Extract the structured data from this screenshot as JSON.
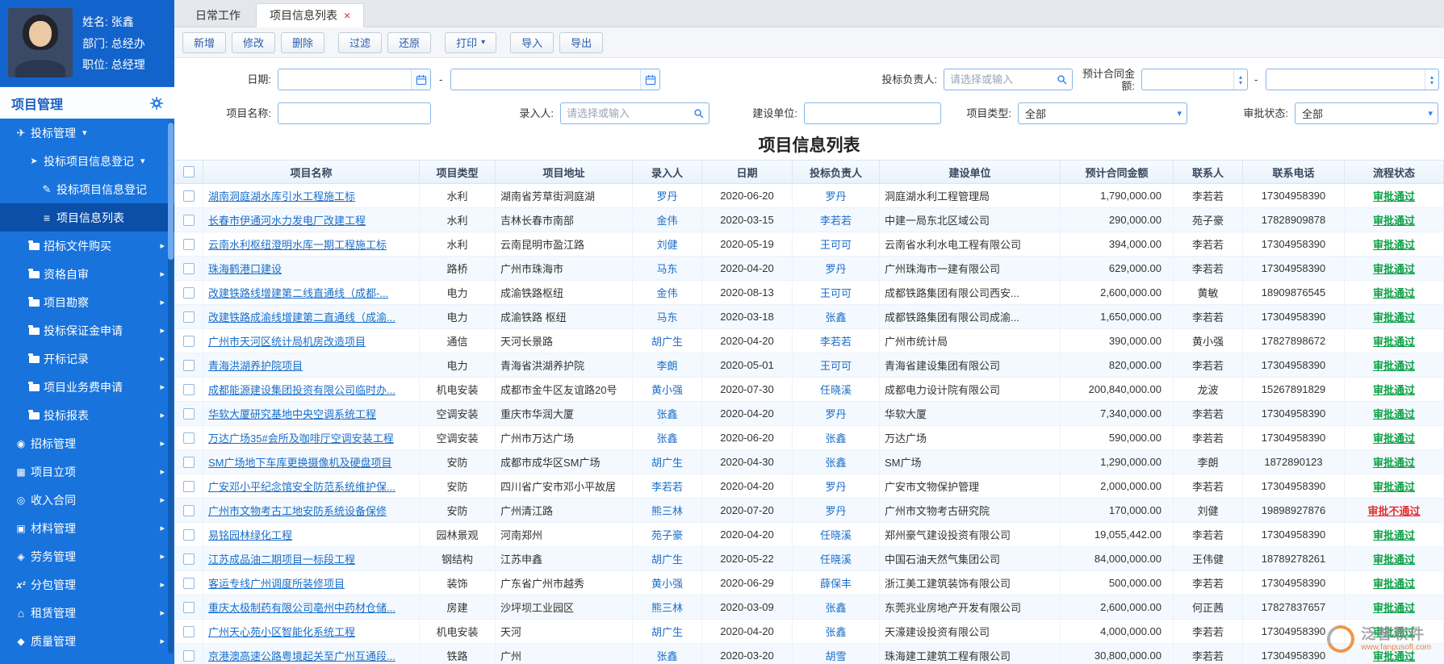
{
  "user": {
    "name": "姓名: 张鑫",
    "department": "部门: 总经办",
    "position": "职位: 总经理"
  },
  "sidebar": {
    "section_title": "项目管理",
    "menu": [
      {
        "label": "投标管理",
        "cls": "lv1",
        "icon": "ic-plane",
        "arrow": "ar-down"
      },
      {
        "label": "投标项目信息登记",
        "cls": "lv2",
        "icon": "ic-send",
        "arrow": "ar-down"
      },
      {
        "label": "投标项目信息登记",
        "cls": "lv3",
        "icon": "ic-edit",
        "arrow": "ar-none"
      },
      {
        "label": "项目信息列表",
        "cls": "lv3 active",
        "icon": "ic-list",
        "arrow": "ar-none"
      },
      {
        "label": "招标文件购买",
        "cls": "lv2",
        "icon": "ic-folder",
        "arrow": "ar-right"
      },
      {
        "label": "资格自审",
        "cls": "lv2",
        "icon": "ic-folder",
        "arrow": "ar-right"
      },
      {
        "label": "项目勘察",
        "cls": "lv2",
        "icon": "ic-folder",
        "arrow": "ar-right"
      },
      {
        "label": "投标保证金申请",
        "cls": "lv2",
        "icon": "ic-folder",
        "arrow": "ar-right"
      },
      {
        "label": "开标记录",
        "cls": "lv2",
        "icon": "ic-folder",
        "arrow": "ar-right"
      },
      {
        "label": "项目业务费申请",
        "cls": "lv2",
        "icon": "ic-folder",
        "arrow": "ar-right"
      },
      {
        "label": "投标报表",
        "cls": "lv2",
        "icon": "ic-folder",
        "arrow": "ar-right"
      },
      {
        "label": "招标管理",
        "cls": "lv1",
        "icon": "ic-drop",
        "arrow": "ar-right"
      },
      {
        "label": "项目立项",
        "cls": "lv1",
        "icon": "ic-box",
        "arrow": "ar-right"
      },
      {
        "label": "收入合同",
        "cls": "lv1",
        "icon": "ic-target",
        "arrow": "ar-right"
      },
      {
        "label": "材料管理",
        "cls": "lv1",
        "icon": "ic-cart",
        "arrow": "ar-right"
      },
      {
        "label": "劳务管理",
        "cls": "lv1",
        "icon": "ic-hands",
        "arrow": "ar-right"
      },
      {
        "label": "分包管理",
        "cls": "lv1",
        "icon": "ic-x2",
        "arrow": "ar-right"
      },
      {
        "label": "租赁管理",
        "cls": "lv1",
        "icon": "ic-home",
        "arrow": "ar-right"
      },
      {
        "label": "质量管理",
        "cls": "lv1",
        "icon": "ic-shield",
        "arrow": "ar-right"
      }
    ]
  },
  "tabs": {
    "daily": {
      "label": "日常工作"
    },
    "active": {
      "label": "项目信息列表",
      "close_icon": "×"
    }
  },
  "toolbar": {
    "buttons": [
      {
        "label": "新增",
        "cls": ""
      },
      {
        "label": "修改",
        "cls": ""
      },
      {
        "label": "删除",
        "cls": ""
      },
      {
        "label": "过滤",
        "cls": "grp"
      },
      {
        "label": "还原",
        "cls": ""
      },
      {
        "label": "打印",
        "cls": "grp has-caret"
      },
      {
        "label": "导入",
        "cls": "grp"
      },
      {
        "label": "导出",
        "cls": ""
      }
    ]
  },
  "filters": {
    "date_label": "日期:",
    "range_separator": "-",
    "bid_leader_label": "投标负责人:",
    "amount_label": "预计合同金额:",
    "project_name_label": "项目名称:",
    "entry_person_label": "录入人:",
    "build_unit_label": "建设单位:",
    "project_type_label": "项目类型:",
    "approval_status_label": "审批状态:",
    "select_placeholder": "请选择或输入",
    "project_type_value": "全部",
    "approval_status_value": "全部"
  },
  "table": {
    "title": "项目信息列表",
    "columns": [
      "项目名称",
      "项目类型",
      "项目地址",
      "录入人",
      "日期",
      "投标负责人",
      "建设单位",
      "预计合同金额",
      "联系人",
      "联系电话",
      "流程状态"
    ],
    "rows": [
      {
        "name": "湖南洞庭湖水库引水工程施工标",
        "type": "水利",
        "address": "湖南省芳草街洞庭湖",
        "entry": "罗丹",
        "date": "2020-06-20",
        "leader": "罗丹",
        "unit": "洞庭湖水利工程管理局",
        "amount": "1,790,000.00",
        "contact": "李若若",
        "phone": "17304958390",
        "status": "审批通过",
        "status_cls": "st-pass"
      },
      {
        "name": "长春市伊通河水力发电厂改建工程",
        "type": "水利",
        "address": "吉林长春市南部",
        "entry": "金伟",
        "date": "2020-03-15",
        "leader": "李若若",
        "unit": "中建一局东北区域公司",
        "amount": "290,000.00",
        "contact": "苑子豪",
        "phone": "17828909878",
        "status": "审批通过",
        "status_cls": "st-pass"
      },
      {
        "name": "云南水利枢纽澄明水库一期工程施工标",
        "type": "水利",
        "address": "云南昆明市盈江路",
        "entry": "刘健",
        "date": "2020-05-19",
        "leader": "王可可",
        "unit": "云南省水利水电工程有限公司",
        "amount": "394,000.00",
        "contact": "李若若",
        "phone": "17304958390",
        "status": "审批通过",
        "status_cls": "st-pass"
      },
      {
        "name": "珠海鹤港口建设",
        "type": "路桥",
        "address": "广州市珠海市",
        "entry": "马东",
        "date": "2020-04-20",
        "leader": "罗丹",
        "unit": "广州珠海市一建有限公司",
        "amount": "629,000.00",
        "contact": "李若若",
        "phone": "17304958390",
        "status": "审批通过",
        "status_cls": "st-pass"
      },
      {
        "name": "改建铁路线增建第二线直通线（成都-...",
        "type": "电力",
        "address": "成渝铁路枢纽",
        "entry": "金伟",
        "date": "2020-08-13",
        "leader": "王可可",
        "unit": "成都铁路集团有限公司西安...",
        "amount": "2,600,000.00",
        "contact": "黄敏",
        "phone": "18909876545",
        "status": "审批通过",
        "status_cls": "st-pass"
      },
      {
        "name": "改建铁路成渝线增建第二直通线（成渝...",
        "type": "电力",
        "address": "成渝铁路 枢纽",
        "entry": "马东",
        "date": "2020-03-18",
        "leader": "张鑫",
        "unit": "成都铁路集团有限公司成渝...",
        "amount": "1,650,000.00",
        "contact": "李若若",
        "phone": "17304958390",
        "status": "审批通过",
        "status_cls": "st-pass"
      },
      {
        "name": "广州市天河区统计局机房改造项目",
        "type": "通信",
        "address": "天河长景路",
        "entry": "胡广生",
        "date": "2020-04-20",
        "leader": "李若若",
        "unit": "广州市统计局",
        "amount": "390,000.00",
        "contact": "黄小强",
        "phone": "17827898672",
        "status": "审批通过",
        "status_cls": "st-pass"
      },
      {
        "name": "青海洪湖养护院项目",
        "type": "电力",
        "address": "青海省洪湖养护院",
        "entry": "李朗",
        "date": "2020-05-01",
        "leader": "王可可",
        "unit": "青海省建设集团有限公司",
        "amount": "820,000.00",
        "contact": "李若若",
        "phone": "17304958390",
        "status": "审批通过",
        "status_cls": "st-pass"
      },
      {
        "name": "成都能源建设集团投资有限公司临时办...",
        "type": "机电安装",
        "address": "成都市金牛区友谊路20号",
        "entry": "黄小强",
        "date": "2020-07-30",
        "leader": "任晓溪",
        "unit": "成都电力设计院有限公司",
        "amount": "200,840,000.00",
        "contact": "龙波",
        "phone": "15267891829",
        "status": "审批通过",
        "status_cls": "st-pass"
      },
      {
        "name": "华软大厦研究基地中央空调系统工程",
        "type": "空调安装",
        "address": "重庆市华润大厦",
        "entry": "张鑫",
        "date": "2020-04-20",
        "leader": "罗丹",
        "unit": "华软大厦",
        "amount": "7,340,000.00",
        "contact": "李若若",
        "phone": "17304958390",
        "status": "审批通过",
        "status_cls": "st-pass"
      },
      {
        "name": "万达广场35#会所及咖啡厅空调安装工程",
        "type": "空调安装",
        "address": "广州市万达广场",
        "entry": "张鑫",
        "date": "2020-06-20",
        "leader": "张鑫",
        "unit": "万达广场",
        "amount": "590,000.00",
        "contact": "李若若",
        "phone": "17304958390",
        "status": "审批通过",
        "status_cls": "st-pass"
      },
      {
        "name": "SM广场地下车库更换摄像机及硬盘项目",
        "type": "安防",
        "address": "成都市成华区SM广场",
        "entry": "胡广生",
        "date": "2020-04-30",
        "leader": "张鑫",
        "unit": "SM广场",
        "amount": "1,290,000.00",
        "contact": "李朗",
        "phone": "1872890123",
        "status": "审批通过",
        "status_cls": "st-pass"
      },
      {
        "name": "广安邓小平纪念馆安全防范系统维护保...",
        "type": "安防",
        "address": "四川省广安市邓小平故居",
        "entry": "李若若",
        "date": "2020-04-20",
        "leader": "罗丹",
        "unit": "广安市文物保护管理",
        "amount": "2,000,000.00",
        "contact": "李若若",
        "phone": "17304958390",
        "status": "审批通过",
        "status_cls": "st-pass"
      },
      {
        "name": "广州市文物考古工地安防系统设备保修",
        "type": "安防",
        "address": "广州清江路",
        "entry": "熊三林",
        "date": "2020-07-20",
        "leader": "罗丹",
        "unit": "广州市文物考古研究院",
        "amount": "170,000.00",
        "contact": "刘健",
        "phone": "19898927876",
        "status": "审批不通过",
        "status_cls": "st-fail"
      },
      {
        "name": "易铭园林绿化工程",
        "type": "园林景观",
        "address": "河南郑州",
        "entry": "苑子豪",
        "date": "2020-04-20",
        "leader": "任晓溪",
        "unit": "郑州豪气建设投资有限公司",
        "amount": "19,055,442.00",
        "contact": "李若若",
        "phone": "17304958390",
        "status": "审批通过",
        "status_cls": "st-pass"
      },
      {
        "name": "江苏成品油二期项目一标段工程",
        "type": "钢结构",
        "address": "江苏申鑫",
        "entry": "胡广生",
        "date": "2020-05-22",
        "leader": "任晓溪",
        "unit": "中国石油天然气集团公司",
        "amount": "84,000,000.00",
        "contact": "王伟健",
        "phone": "18789278261",
        "status": "审批通过",
        "status_cls": "st-pass"
      },
      {
        "name": "客运专线广州调度所装修项目",
        "type": "装饰",
        "address": "广东省广州市越秀",
        "entry": "黄小强",
        "date": "2020-06-29",
        "leader": "薛保丰",
        "unit": "浙江美工建筑装饰有限公司",
        "amount": "500,000.00",
        "contact": "李若若",
        "phone": "17304958390",
        "status": "审批通过",
        "status_cls": "st-pass"
      },
      {
        "name": "重庆太极制药有限公司亳州中药材仓储...",
        "type": "房建",
        "address": "沙坪坝工业园区",
        "entry": "熊三林",
        "date": "2020-03-09",
        "leader": "张鑫",
        "unit": "东莞兆业房地产开发有限公司",
        "amount": "2,600,000.00",
        "contact": "何正茜",
        "phone": "17827837657",
        "status": "审批通过",
        "status_cls": "st-pass"
      },
      {
        "name": "广州天心苑小区智能化系统工程",
        "type": "机电安装",
        "address": "天河",
        "entry": "胡广生",
        "date": "2020-04-20",
        "leader": "张鑫",
        "unit": "天濠建设投资有限公司",
        "amount": "4,000,000.00",
        "contact": "李若若",
        "phone": "17304958390",
        "status": "审批通过",
        "status_cls": "st-pass"
      },
      {
        "name": "京港澳高速公路粤境起关至广州互通段...",
        "type": "铁路",
        "address": "广州",
        "entry": "张鑫",
        "date": "2020-03-20",
        "leader": "胡雪",
        "unit": "珠海建工建筑工程有限公司",
        "amount": "30,800,000.00",
        "contact": "李若若",
        "phone": "17304958390",
        "status": "审批通过",
        "status_cls": "st-pass"
      }
    ]
  },
  "watermark": {
    "brand": "泛普软件",
    "url": "www.fanpusoft.com"
  }
}
